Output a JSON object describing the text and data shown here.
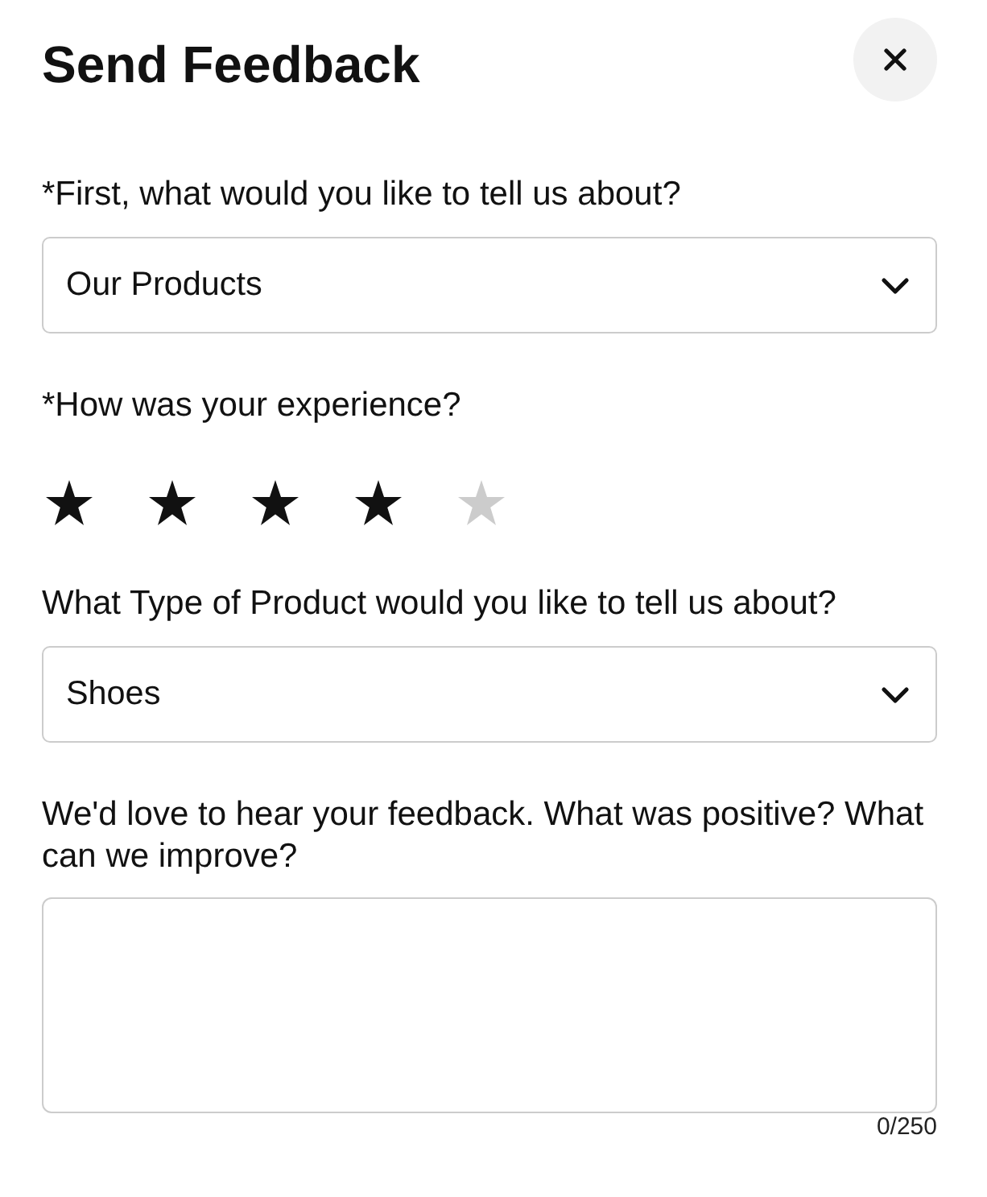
{
  "dialog": {
    "title": "Send Feedback"
  },
  "fields": [
    {
      "kind": "select",
      "label": "*First, what would you like to tell us about?",
      "value": "Our Products"
    },
    {
      "kind": "rating",
      "label": "*How was your experience?",
      "stars": 4
    },
    {
      "kind": "select",
      "label": "What Type of Product would you like to tell us about?",
      "value": "Shoes"
    },
    {
      "kind": "textarea",
      "label": "We'd love to hear your feedback. What was positive? What can we improve?",
      "counter": "0/250"
    }
  ]
}
